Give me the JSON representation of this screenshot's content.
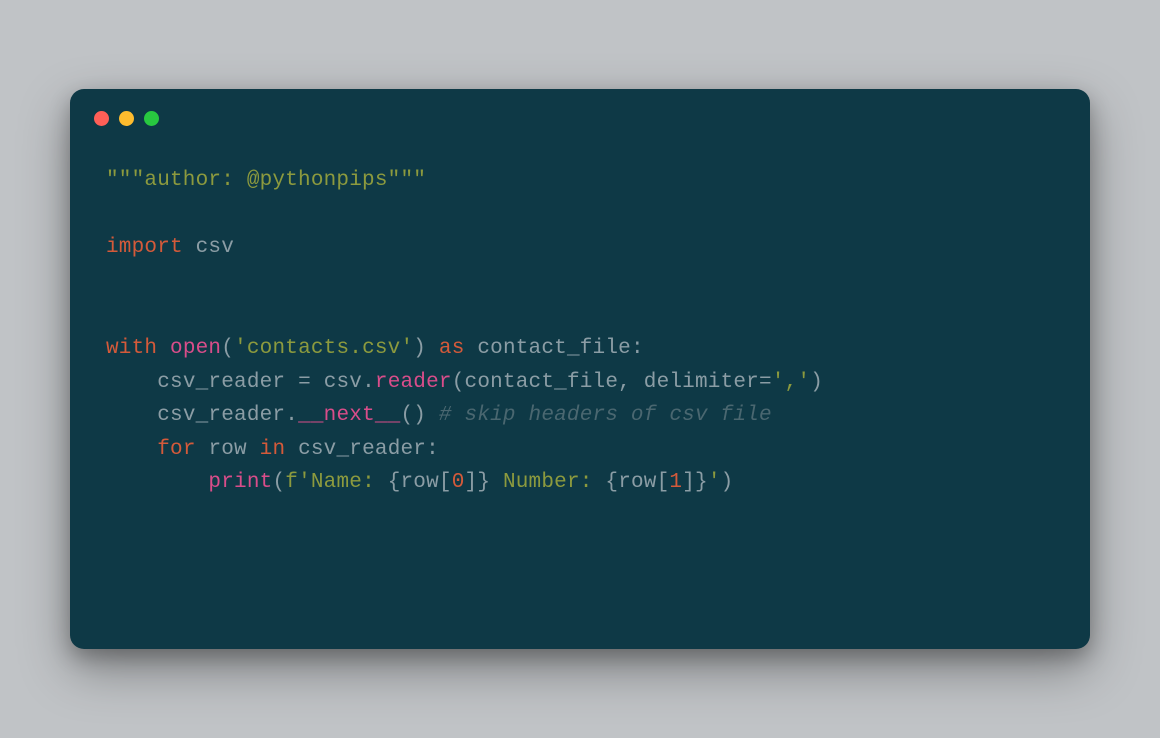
{
  "titlebar": {
    "close_label": "close",
    "minimize_label": "minimize",
    "maximize_label": "maximize"
  },
  "code": {
    "line1": {
      "docstring": "\"\"\"author: @pythonpips\"\"\""
    },
    "line3": {
      "kw_import": "import",
      "module": " csv"
    },
    "line6": {
      "kw_with": "with",
      "space1": " ",
      "fn_open": "open",
      "paren_open": "(",
      "str_filename": "'contacts.csv'",
      "paren_close": ")",
      "space2": " ",
      "kw_as": "as",
      "space3": " ",
      "var_file": "contact_file",
      "colon": ":"
    },
    "line7": {
      "indent": "    ",
      "var_reader": "csv_reader",
      "space1": " ",
      "op_eq": "=",
      "space2": " ",
      "mod_csv": "csv",
      "dot": ".",
      "fn_reader": "reader",
      "paren_open": "(",
      "arg_file": "contact_file",
      "comma_sp": ", ",
      "kw_delim": "delimiter",
      "op_eq2": "=",
      "str_delim": "','",
      "paren_close": ")"
    },
    "line8": {
      "indent": "    ",
      "var_reader": "csv_reader",
      "dot": ".",
      "fn_next": "__next__",
      "parens": "()",
      "space": " ",
      "comment": "# skip headers of csv file"
    },
    "line9": {
      "indent": "    ",
      "kw_for": "for",
      "space1": " ",
      "var_row": "row",
      "space2": " ",
      "kw_in": "in",
      "space3": " ",
      "var_reader": "csv_reader",
      "colon": ":"
    },
    "line10": {
      "indent": "        ",
      "fn_print": "print",
      "paren_open": "(",
      "f_prefix": "f",
      "qopen": "'",
      "str_name": "Name: ",
      "brace_o1": "{",
      "expr_row1": "row",
      "bracket_o1": "[",
      "num_0": "0",
      "bracket_c1": "]",
      "brace_c1": "}",
      "str_number": " Number: ",
      "brace_o2": "{",
      "expr_row2": "row",
      "bracket_o2": "[",
      "num_1": "1",
      "bracket_c2": "]",
      "brace_c2": "}",
      "qclose": "'",
      "paren_close": ")"
    }
  }
}
